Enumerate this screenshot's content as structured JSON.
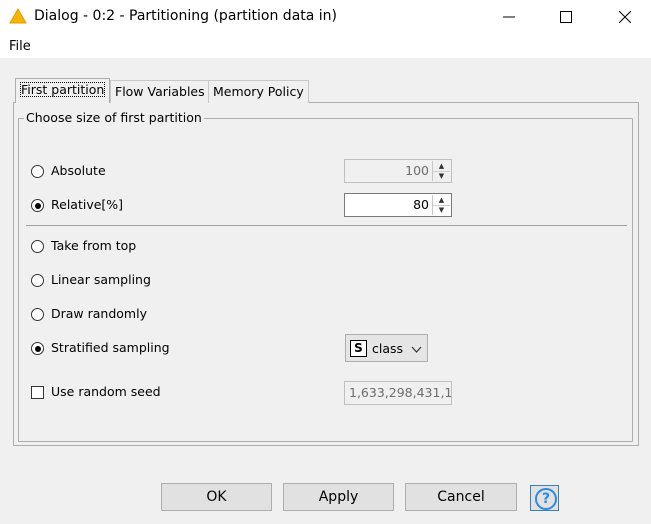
{
  "window": {
    "title": "Dialog - 0:2 - Partitioning (partition data in)",
    "icon": "warning-triangle-icon",
    "minimize_glyph": "—",
    "maximize_glyph": "☐",
    "close_glyph": "✕"
  },
  "menu": {
    "file": "File"
  },
  "tabs": [
    {
      "label": "First partition",
      "active": true
    },
    {
      "label": "Flow Variables",
      "active": false
    },
    {
      "label": "Memory Policy",
      "active": false
    }
  ],
  "group": {
    "title": "Choose size of first partition",
    "absolute": {
      "label": "Absolute",
      "selected": false,
      "value": "100",
      "enabled": false
    },
    "relative": {
      "label": "Relative[%]",
      "selected": true,
      "value": "80",
      "enabled": true
    },
    "methods": [
      {
        "label": "Take from top",
        "selected": false
      },
      {
        "label": "Linear sampling",
        "selected": false
      },
      {
        "label": "Draw randomly",
        "selected": false
      },
      {
        "label": "Stratified sampling",
        "selected": true
      }
    ],
    "class_column": {
      "badge": "S",
      "value": "class"
    },
    "random_seed": {
      "label": "Use random seed",
      "checked": false,
      "value": "1,633,298,431,1"
    }
  },
  "buttons": {
    "ok": "OK",
    "apply": "Apply",
    "cancel": "Cancel",
    "help": "?"
  },
  "colors": {
    "accent": "#2c8ce0",
    "warning_icon": "#f4b400"
  }
}
